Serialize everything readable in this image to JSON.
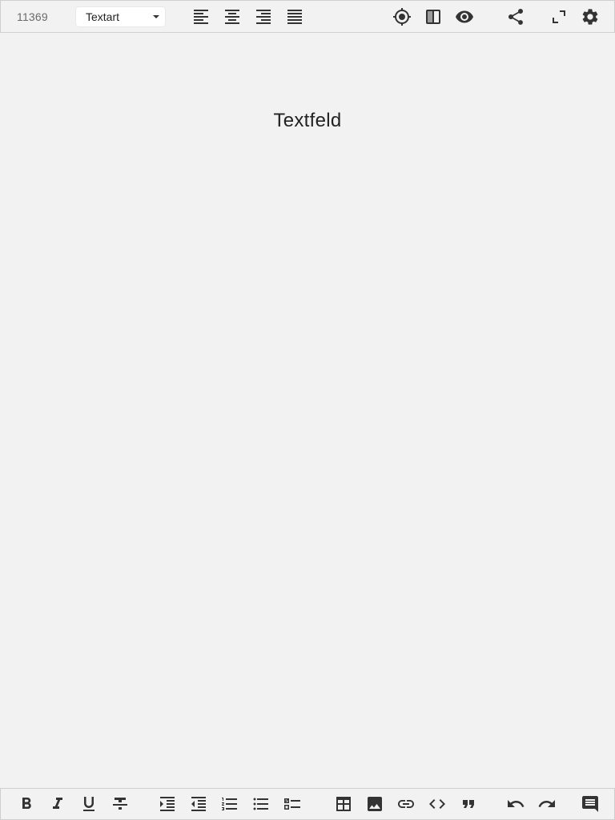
{
  "toolbar": {
    "word_count": "11369",
    "text_type": {
      "selected": "Textart"
    },
    "align_left_icon": "format-align-left",
    "align_center_icon": "format-align-center",
    "align_right_icon": "format-align-right",
    "align_justify_icon": "format-align-justify",
    "focus_icon": "crosshairs-gps",
    "split_view_icon": "view-split",
    "preview_icon": "eye",
    "share_icon": "share",
    "fullscreen_icon": "fullscreen",
    "settings_icon": "settings"
  },
  "editor": {
    "placeholder": "Textfeld"
  },
  "formatbar": {
    "icons": [
      "bold",
      "italic",
      "underline",
      "strikethrough",
      "indent",
      "outdent",
      "numbered-list",
      "bulleted-list",
      "checklist",
      "table",
      "image",
      "link",
      "code",
      "quote",
      "undo",
      "redo",
      "comment"
    ]
  }
}
